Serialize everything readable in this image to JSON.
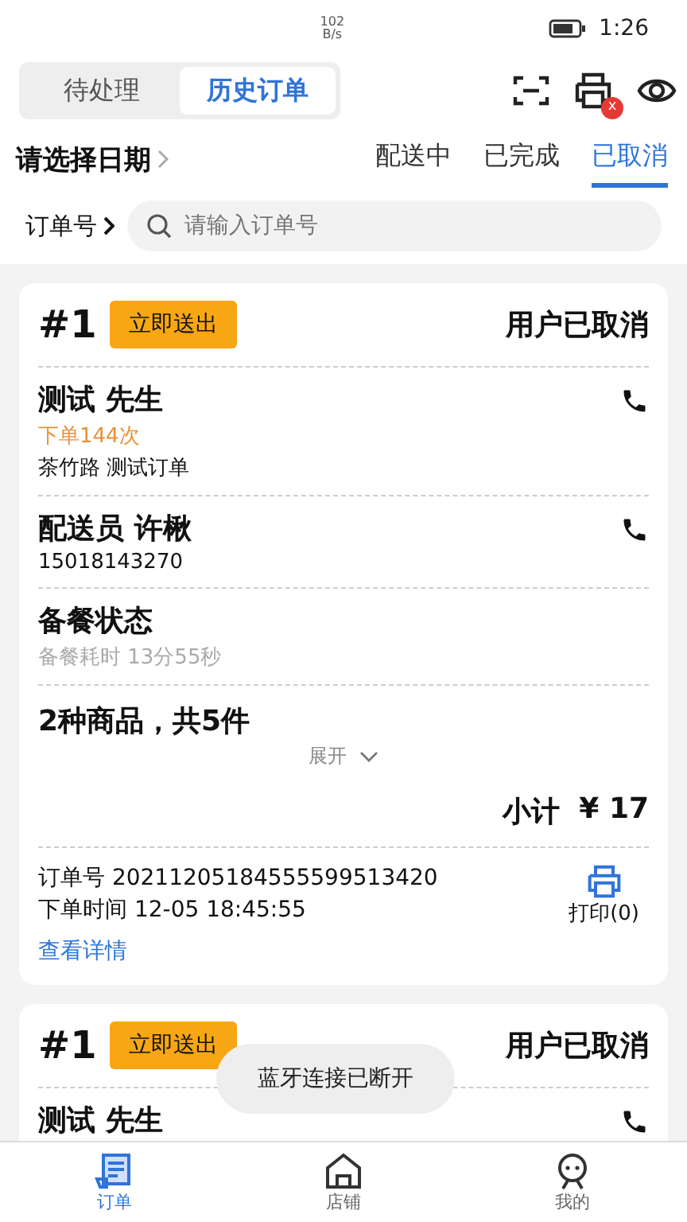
{
  "status_bar": {
    "net_speed": "102",
    "net_unit": "B/s",
    "time": "1:26"
  },
  "top_tabs": [
    {
      "label": "待处理",
      "selected": false
    },
    {
      "label": "历史订单",
      "selected": true
    }
  ],
  "printer_badge": "x",
  "date_picker": "请选择日期",
  "status_tabs": [
    {
      "label": "配送中",
      "selected": false
    },
    {
      "label": "已完成",
      "selected": false
    },
    {
      "label": "已取消",
      "selected": true
    }
  ],
  "search": {
    "label": "订单号",
    "placeholder": "请输入订单号"
  },
  "orders": [
    {
      "number": "#1",
      "action": "立即送出",
      "status": "用户已取消",
      "customer": {
        "name": "测试 先生",
        "order_count": "下单144次",
        "address": "茶竹路 测试订单"
      },
      "courier": {
        "name": "配送员 许楸",
        "phone": "15018143270"
      },
      "prep": {
        "title": "备餐状态",
        "detail": "备餐耗时 13分55秒"
      },
      "goods": "2种商品，共5件",
      "expand": "展开",
      "subtotal_label": "小计",
      "subtotal": "¥ 17",
      "order_no": "订单号 20211205184555599513420",
      "order_time": "下单时间 12-05 18:45:55",
      "print": "打印(0)",
      "details": "查看详情"
    },
    {
      "number": "#1",
      "action": "立即送出",
      "status": "用户已取消",
      "customer": {
        "name": "测试 先生"
      }
    }
  ],
  "toast": "蓝牙连接已断开",
  "nav": [
    {
      "kind": "orders",
      "label": "订单",
      "selected": true
    },
    {
      "kind": "store",
      "label": "店铺",
      "selected": false
    },
    {
      "kind": "profile",
      "label": "我的",
      "selected": false
    }
  ]
}
